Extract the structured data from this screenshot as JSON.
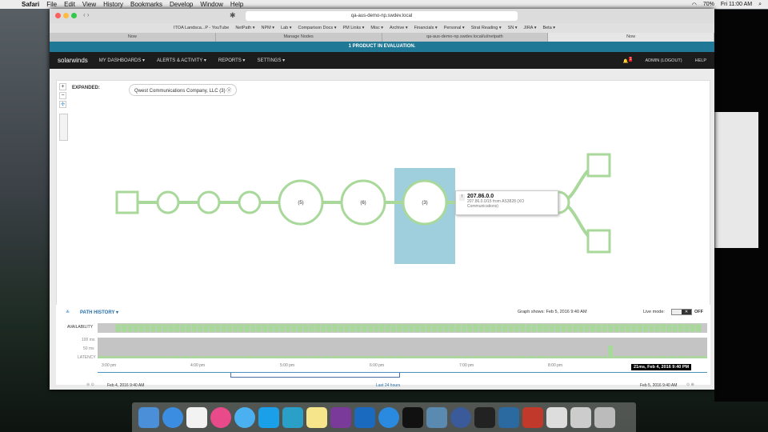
{
  "menubar": {
    "app": "Safari",
    "items": [
      "File",
      "Edit",
      "View",
      "History",
      "Bookmarks",
      "Develop",
      "Window",
      "Help"
    ],
    "battery": "70%",
    "clock": "Fri 11:00 AM"
  },
  "browser": {
    "url": "qa-aus-demo-np.swdev.local",
    "bookmarks": [
      "ITOA Landsca...P - YouTube",
      "NetPath ▾",
      "NPM ▾",
      "Lab ▾",
      "Comparison Docs ▾",
      "PM Links ▾",
      "Misc ▾",
      "Archive ▾",
      "Financials ▾",
      "Personal ▾",
      "Strat Reading ▾",
      "SN ▾",
      "JIRA ▾",
      "Beta ▾"
    ],
    "tabs": [
      "Now",
      "Manage Nodes",
      "qa-aus-demo-np.swdev.local/ui/netpath",
      "Now"
    ]
  },
  "banner": "1 PRODUCT IN EVALUATION.",
  "nav": {
    "logo": "solarwinds",
    "items": [
      "MY DASHBOARDS ▾",
      "ALERTS & ACTIVITY ▾",
      "REPORTS ▾",
      "SETTINGS ▾"
    ],
    "notification_count": "1",
    "admin": "ADMIN (LOGOUT)",
    "help": "HELP"
  },
  "map": {
    "expanded_label": "EXPANDED:",
    "expanded_chip": "Qwest Communications Company, LLC (3)",
    "node_labels": [
      "(5)",
      "(6)",
      "(3)"
    ],
    "tooltip": {
      "title": "207.86.0.0",
      "line1": "207.86.0.0/15 from AS3828 (XO",
      "line2": "Communications)"
    },
    "colors": {
      "path": "#a8d89a",
      "highlight": "#9fcfdd"
    }
  },
  "history": {
    "title": "PATH HISTORY",
    "graph_shows": "Graph shows: Feb 5, 2016 9:40 AM",
    "live_mode": "Live mode:",
    "live_state": "OFF",
    "availability": "AVAILABILITY",
    "lat100": "100 ms",
    "lat50": "50 ms",
    "latency": "LATENCY",
    "times": [
      "3:00 pm",
      "4:00 pm",
      "5:00 pm",
      "6:00 pm",
      "7:00 pm",
      "8:00 pm"
    ],
    "tooltip": "21ms, Feb 4, 2016 9:40 PM",
    "range_start": "Feb 4, 2016 9:40 AM",
    "range_label": "Last 24 hours",
    "range_end": "Feb 5, 2016 9:40 AM"
  }
}
